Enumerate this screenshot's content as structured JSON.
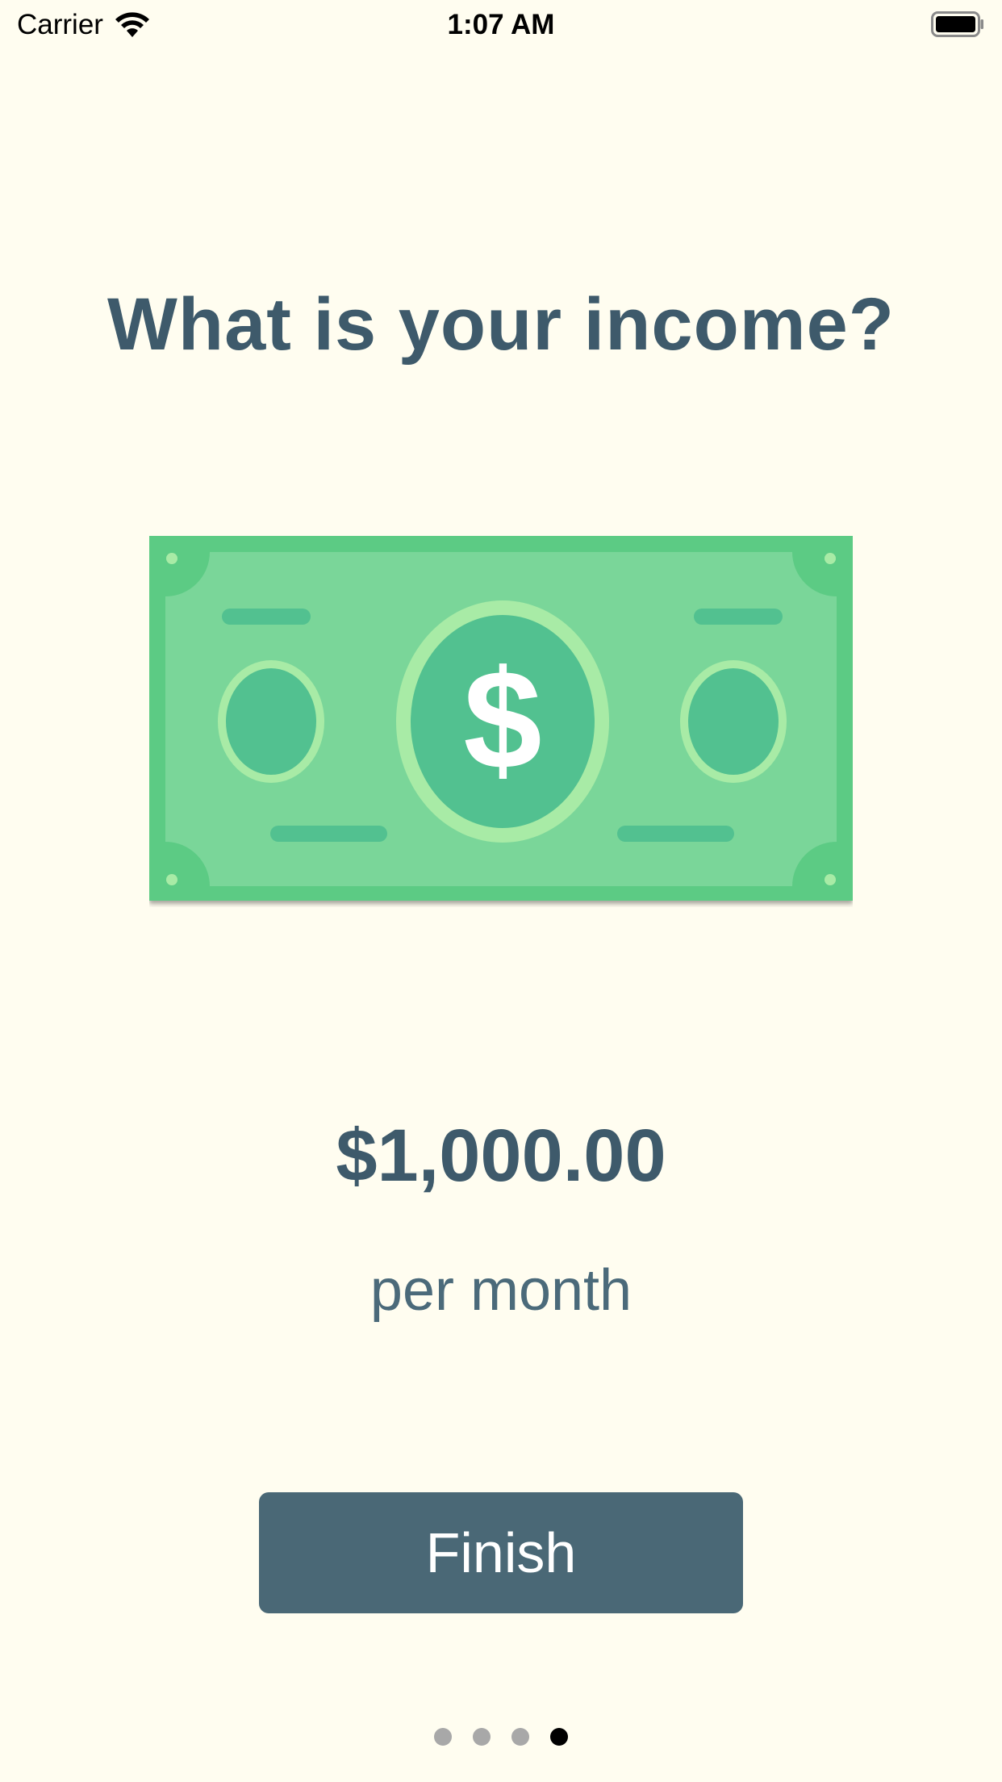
{
  "status_bar": {
    "carrier": "Carrier",
    "time": "1:07 AM",
    "wifi_icon": "wifi-icon",
    "battery_icon": "battery-icon"
  },
  "title": "What is your income?",
  "illustration": {
    "icon": "dollar-bill-icon",
    "symbol": "$",
    "colors": {
      "outer": "#5ccb84",
      "inner": "#7ad699",
      "medallion": "#52c190",
      "medallion_ring": "#a8eba6"
    }
  },
  "income": {
    "amount": "$1,000.00",
    "period": "per month"
  },
  "finish_button": {
    "label": "Finish"
  },
  "pagination": {
    "total": 4,
    "current": 4
  },
  "colors": {
    "background": "#fffdf0",
    "text": "#3e5a6b",
    "button": "#4a6876"
  }
}
